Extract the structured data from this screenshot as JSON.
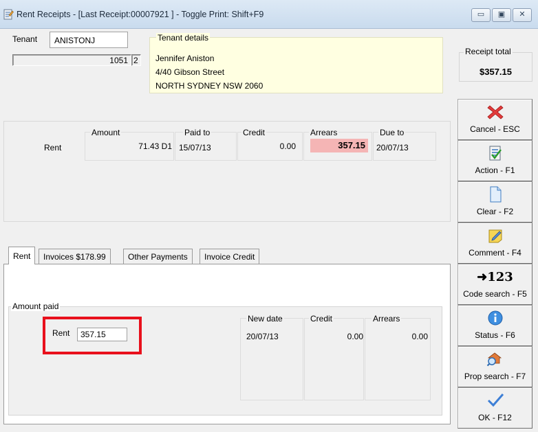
{
  "window": {
    "title": "Rent Receipts - [Last Receipt:00007921 ] - Toggle Print: Shift+F9",
    "minimize": "▭",
    "maximize": "▣",
    "close": "✕"
  },
  "tenant": {
    "label": "Tenant",
    "code": "ANISTONJ",
    "number": "1051",
    "sub": "2"
  },
  "tenant_details": {
    "legend": "Tenant details",
    "name": "Jennifer Aniston",
    "street": "4/40 Gibson Street",
    "suburb": "NORTH SYDNEY  NSW  2060"
  },
  "receipt_total": {
    "label": "Receipt total",
    "value": "$357.15"
  },
  "ledger": {
    "headers": {
      "amount": "Amount",
      "paid_to": "Paid to",
      "credit": "Credit",
      "arrears": "Arrears",
      "due_to": "Due to"
    },
    "row": {
      "label": "Rent",
      "amount": "71.43 D1",
      "paid_to": "15/07/13",
      "credit": "0.00",
      "arrears": "357.15",
      "due_to": "20/07/13"
    }
  },
  "tabs": [
    {
      "label": "Rent"
    },
    {
      "label": "Invoices  $178.99"
    },
    {
      "label": "Other Payments"
    },
    {
      "label": "Invoice Credit"
    }
  ],
  "amount_paid": {
    "legend": "Amount paid",
    "rent_label": "Rent",
    "rent_value": "357.15",
    "headers": {
      "new_date": "New date",
      "credit": "Credit",
      "arrears": "Arrears"
    },
    "row": {
      "new_date": "20/07/13",
      "credit": "0.00",
      "arrears": "0.00"
    }
  },
  "side_buttons": {
    "cancel": "Cancel - ESC",
    "action": "Action - F1",
    "clear": "Clear - F2",
    "comment": "Comment - F4",
    "code_search": "Code search - F5",
    "code_search_glyph": "➜123",
    "status": "Status - F6",
    "prop_search": "Prop search - F7",
    "ok": "OK - F12"
  },
  "colors": {
    "arrears_bg": "#f5b5b5",
    "tenant_details_bg": "#ffffe1",
    "highlight_red": "#e8101c"
  }
}
